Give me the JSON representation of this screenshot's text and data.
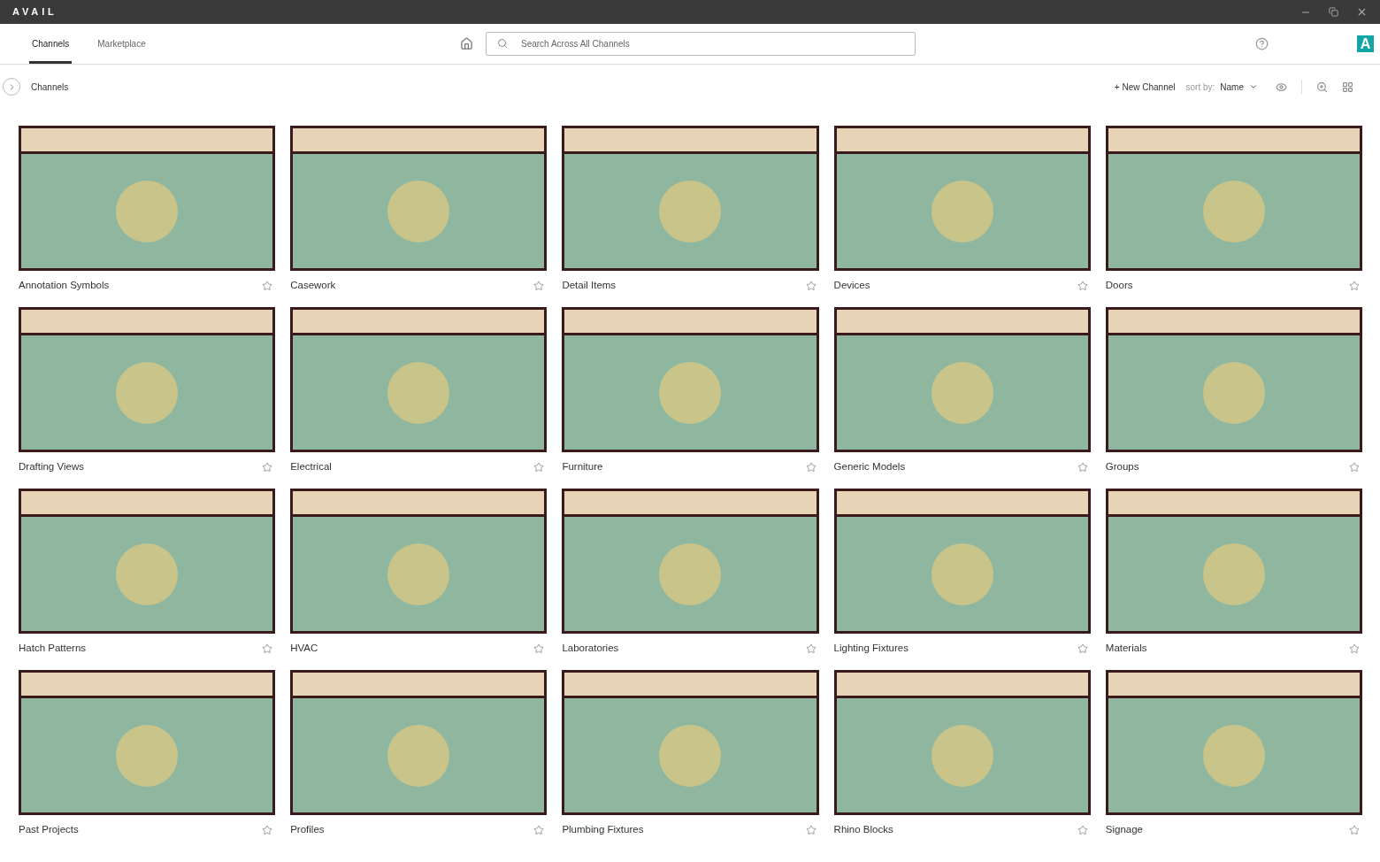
{
  "app": {
    "title": "AVAIL",
    "avatar": "A"
  },
  "tabs": [
    {
      "label": "Channels",
      "selected": true
    },
    {
      "label": "Marketplace",
      "selected": false
    }
  ],
  "search": {
    "placeholder": "Search Across All Channels"
  },
  "toolbar": {
    "breadcrumb": "Channels",
    "new_channel": "+ New Channel",
    "sort_label": "sort by:",
    "sort_value": "Name"
  },
  "channels": [
    {
      "name": "Annotation Symbols"
    },
    {
      "name": "Casework"
    },
    {
      "name": "Detail Items"
    },
    {
      "name": "Devices"
    },
    {
      "name": "Doors"
    },
    {
      "name": "Drafting Views"
    },
    {
      "name": "Electrical"
    },
    {
      "name": "Furniture"
    },
    {
      "name": "Generic Models"
    },
    {
      "name": "Groups"
    },
    {
      "name": "Hatch Patterns"
    },
    {
      "name": "HVAC"
    },
    {
      "name": "Laboratories"
    },
    {
      "name": "Lighting Fixtures"
    },
    {
      "name": "Materials"
    },
    {
      "name": "Past Projects"
    },
    {
      "name": "Profiles"
    },
    {
      "name": "Plumbing Fixtures"
    },
    {
      "name": "Rhino Blocks"
    },
    {
      "name": "Signage"
    }
  ]
}
